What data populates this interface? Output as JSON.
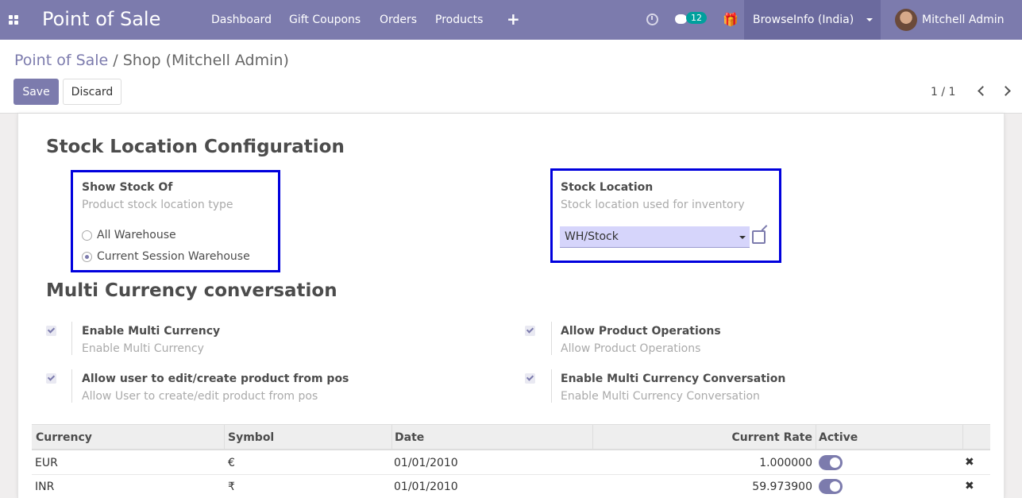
{
  "navbar": {
    "app_title": "Point of Sale",
    "menu": [
      "Dashboard",
      "Gift Coupons",
      "Orders",
      "Products"
    ],
    "plus_symbol": "+",
    "chat_badge": "12",
    "company": "BrowseInfo (India)",
    "user": "Mitchell Admin",
    "icons": [
      "apps-icon",
      "clock-icon",
      "chat-icon",
      "gift-icon",
      "avatar"
    ]
  },
  "control_panel": {
    "breadcrumb_parent": "Point of Sale",
    "breadcrumb_sep": "/",
    "breadcrumb_current": "Shop (Mitchell Admin)",
    "save_label": "Save",
    "discard_label": "Discard",
    "pager": "1 / 1"
  },
  "stock_config": {
    "title": "Stock Location Configuration",
    "show_stock": {
      "label": "Show Stock Of",
      "help": "Product stock location type",
      "options": [
        {
          "label": "All Warehouse",
          "checked": false
        },
        {
          "label": "Current Session Warehouse",
          "checked": true
        }
      ]
    },
    "stock_location": {
      "label": "Stock Location",
      "help": "Stock location used for inventory",
      "value": "WH/Stock"
    }
  },
  "multi_currency": {
    "title": "Multi Currency conversation",
    "settings": [
      {
        "label": "Enable Multi Currency",
        "help": "Enable Multi Currency",
        "checked": true
      },
      {
        "label": "Allow Product Operations",
        "help": "Allow Product Operations",
        "checked": true
      },
      {
        "label": "Allow user to edit/create product from pos",
        "help": "Allow User to create/edit product from pos",
        "checked": true
      },
      {
        "label": "Enable Multi Currency Conversation",
        "help": "Enable Multi Currency Conversation",
        "checked": true
      }
    ]
  },
  "currency_table": {
    "headers": [
      "Currency",
      "Symbol",
      "Date",
      "Current Rate",
      "Active"
    ],
    "rows": [
      {
        "currency": "EUR",
        "symbol": "€",
        "date": "01/01/2010",
        "rate": "1.000000",
        "active": true
      },
      {
        "currency": "INR",
        "symbol": "₹",
        "date": "01/01/2010",
        "rate": "59.973900",
        "active": true
      }
    ],
    "delete_symbol": "✖"
  },
  "colors": {
    "brand": "#7c7bad",
    "highlight_border": "#0000dd",
    "select_bg": "#d6d5fb"
  }
}
